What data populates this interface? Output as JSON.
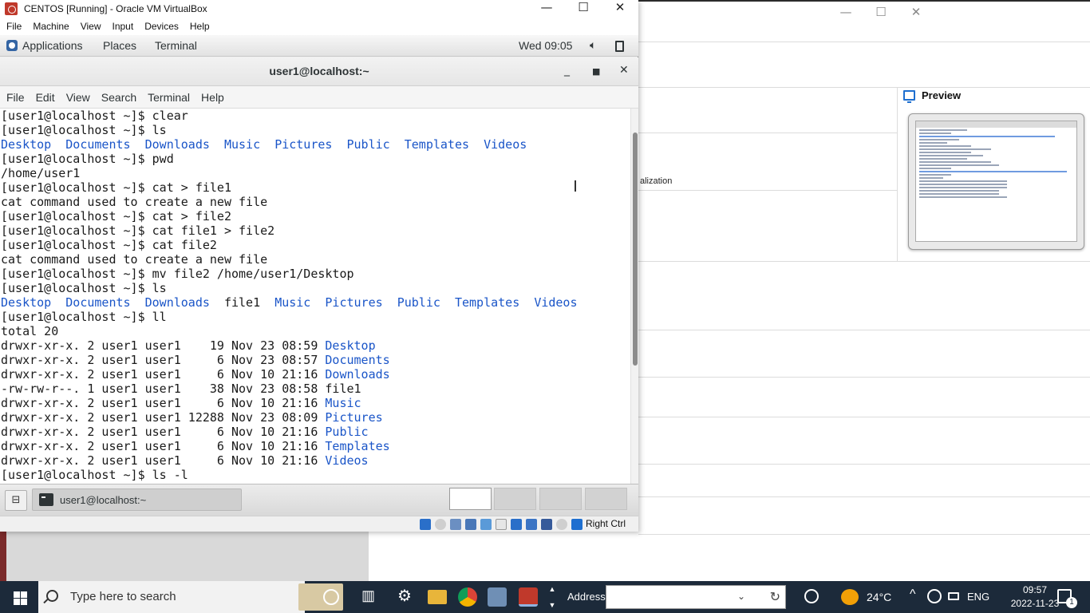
{
  "vm": {
    "title": "CENTOS [Running] - Oracle VM VirtualBox",
    "menu": [
      "File",
      "Machine",
      "View",
      "Input",
      "Devices",
      "Help"
    ],
    "host_key": "Right Ctrl"
  },
  "gnome": {
    "applications": "Applications",
    "places": "Places",
    "terminal": "Terminal",
    "clock": "Wed 09:05"
  },
  "terminal": {
    "title": "user1@localhost:~",
    "menu": [
      "File",
      "Edit",
      "View",
      "Search",
      "Terminal",
      "Help"
    ],
    "lines": [
      [
        {
          "t": "[user1@localhost ~]$ clear"
        }
      ],
      [
        {
          "t": "[user1@localhost ~]$ ls"
        }
      ],
      [
        {
          "t": "Desktop",
          "d": true
        },
        {
          "t": "  "
        },
        {
          "t": "Documents",
          "d": true
        },
        {
          "t": "  "
        },
        {
          "t": "Downloads",
          "d": true
        },
        {
          "t": "  "
        },
        {
          "t": "Music",
          "d": true
        },
        {
          "t": "  "
        },
        {
          "t": "Pictures",
          "d": true
        },
        {
          "t": "  "
        },
        {
          "t": "Public",
          "d": true
        },
        {
          "t": "  "
        },
        {
          "t": "Templates",
          "d": true
        },
        {
          "t": "  "
        },
        {
          "t": "Videos",
          "d": true
        }
      ],
      [
        {
          "t": "[user1@localhost ~]$ pwd"
        }
      ],
      [
        {
          "t": "/home/user1"
        }
      ],
      [
        {
          "t": "[user1@localhost ~]$ cat > file1"
        }
      ],
      [
        {
          "t": "cat command used to create a new file"
        }
      ],
      [
        {
          "t": "[user1@localhost ~]$ cat > file2"
        }
      ],
      [
        {
          "t": "[user1@localhost ~]$ cat file1 > file2"
        }
      ],
      [
        {
          "t": "[user1@localhost ~]$ cat file2"
        }
      ],
      [
        {
          "t": "cat command used to create a new file"
        }
      ],
      [
        {
          "t": "[user1@localhost ~]$ mv file2 /home/user1/Desktop"
        }
      ],
      [
        {
          "t": "[user1@localhost ~]$ ls"
        }
      ],
      [
        {
          "t": "Desktop",
          "d": true
        },
        {
          "t": "  "
        },
        {
          "t": "Documents",
          "d": true
        },
        {
          "t": "  "
        },
        {
          "t": "Downloads",
          "d": true
        },
        {
          "t": "  file1  "
        },
        {
          "t": "Music",
          "d": true
        },
        {
          "t": "  "
        },
        {
          "t": "Pictures",
          "d": true
        },
        {
          "t": "  "
        },
        {
          "t": "Public",
          "d": true
        },
        {
          "t": "  "
        },
        {
          "t": "Templates",
          "d": true
        },
        {
          "t": "  "
        },
        {
          "t": "Videos",
          "d": true
        }
      ],
      [
        {
          "t": "[user1@localhost ~]$ ll"
        }
      ],
      [
        {
          "t": "total 20"
        }
      ],
      [
        {
          "t": "drwxr-xr-x. 2 user1 user1    19 Nov 23 08:59 "
        },
        {
          "t": "Desktop",
          "d": true
        }
      ],
      [
        {
          "t": "drwxr-xr-x. 2 user1 user1     6 Nov 23 08:57 "
        },
        {
          "t": "Documents",
          "d": true
        }
      ],
      [
        {
          "t": "drwxr-xr-x. 2 user1 user1     6 Nov 10 21:16 "
        },
        {
          "t": "Downloads",
          "d": true
        }
      ],
      [
        {
          "t": "-rw-rw-r--. 1 user1 user1    38 Nov 23 08:58 file1"
        }
      ],
      [
        {
          "t": "drwxr-xr-x. 2 user1 user1     6 Nov 10 21:16 "
        },
        {
          "t": "Music",
          "d": true
        }
      ],
      [
        {
          "t": "drwxr-xr-x. 2 user1 user1 12288 Nov 23 08:09 "
        },
        {
          "t": "Pictures",
          "d": true
        }
      ],
      [
        {
          "t": "drwxr-xr-x. 2 user1 user1     6 Nov 10 21:16 "
        },
        {
          "t": "Public",
          "d": true
        }
      ],
      [
        {
          "t": "drwxr-xr-x. 2 user1 user1     6 Nov 10 21:16 "
        },
        {
          "t": "Templates",
          "d": true
        }
      ],
      [
        {
          "t": "drwxr-xr-x. 2 user1 user1     6 Nov 10 21:16 "
        },
        {
          "t": "Videos",
          "d": true
        }
      ],
      [
        {
          "t": "[user1@localhost ~]$ ls -l"
        }
      ]
    ],
    "dir_color": "#1a55c8"
  },
  "gnome_taskbar": {
    "task_label": "user1@localhost:~"
  },
  "manager": {
    "preview_label": "Preview",
    "snippet": "alization"
  },
  "windows": {
    "search_placeholder": "Type here to search",
    "address_label": "Address",
    "weather": "24°C",
    "language": "ENG",
    "time": "09:57",
    "date": "2022-11-23",
    "notifications": "1"
  },
  "icons": {
    "start": "windows-logo-icon",
    "search": "search-icon",
    "cortana": "cortana-icon",
    "taskview": "task-view-icon",
    "settings": "gear-icon",
    "explorer": "folder-icon",
    "chrome": "chrome-icon",
    "virtualbox": "virtualbox-icon"
  }
}
